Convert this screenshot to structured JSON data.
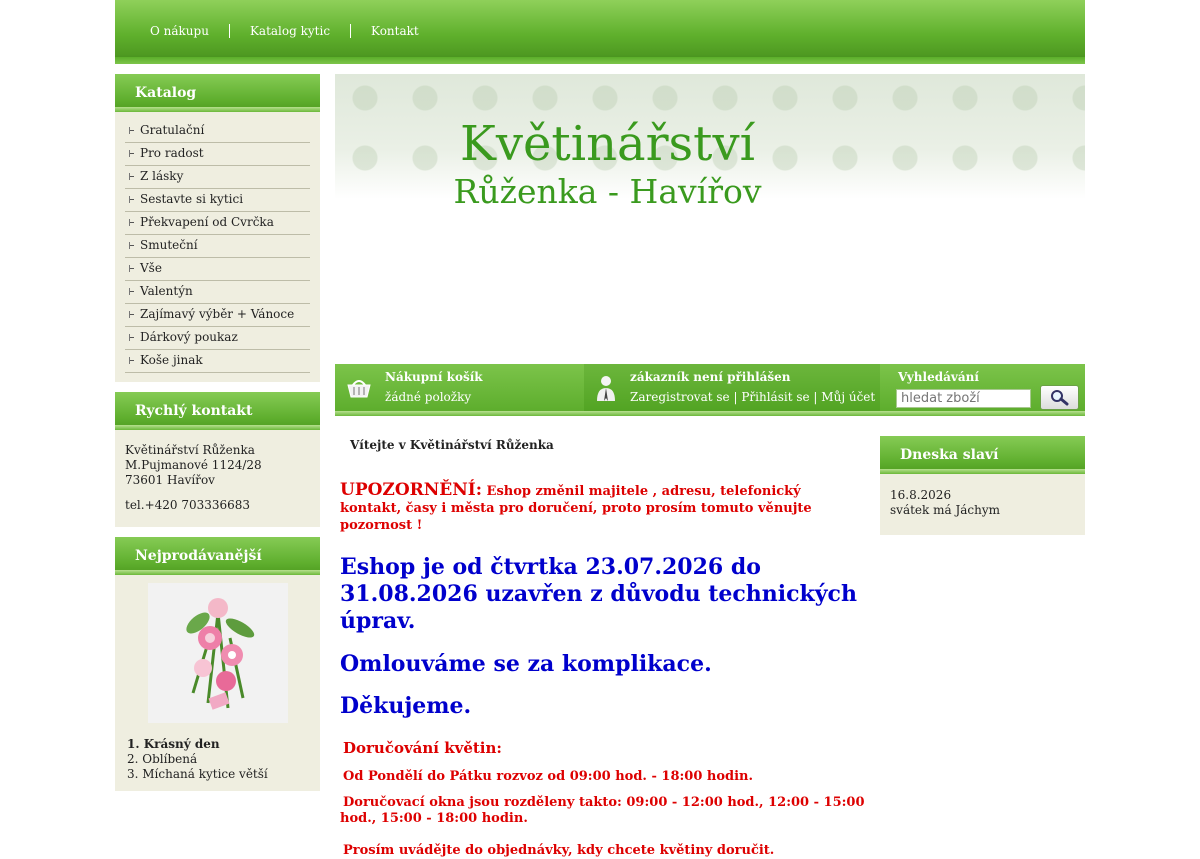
{
  "nav": {
    "items": [
      "O nákupu",
      "Katalog kytic",
      "Kontakt"
    ]
  },
  "catalog": {
    "title": "Katalog",
    "items": [
      "Gratulační",
      "Pro radost",
      "Z lásky",
      "Sestavte si kytici",
      "Překvapení od Cvrčka",
      "Smuteční",
      "Vše",
      "Valentýn",
      "Zajímavý výběr + Vánoce",
      "Dárkový poukaz",
      "Koše jinak"
    ]
  },
  "contact": {
    "title": "Rychlý kontakt",
    "line1": "Květinářství Růženka",
    "line2": "M.Pujmanové 1124/28",
    "line3": "73601 Havířov",
    "phone": "tel.+420 703336683"
  },
  "bestsellers": {
    "title": "Nejprodávanější",
    "items": [
      "1. Krásný den",
      "2. Oblíbená",
      "3. Míchaná kytice větší"
    ]
  },
  "banner": {
    "title": "Květinářství",
    "subtitle": "Růženka - Havířov"
  },
  "cart": {
    "title": "Nákupní košík",
    "status": "žádné položky"
  },
  "user": {
    "title": "zákazník není přihlášen",
    "register": "Zaregistrovat se",
    "login": "Přihlásit se",
    "account": "Můj účet",
    "sep": "|"
  },
  "search": {
    "title": "Vyhledávání",
    "placeholder": "hledat zboží"
  },
  "main": {
    "welcome": "Vítejte v Květinářství Růženka",
    "warn_label": "UPOZORNĚNÍ:",
    "warn_text": " Eshop změnil majitele , adresu, telefonický kontakt, časy i města pro doručení, proto prosím tomuto věnujte pozornost !",
    "closed": "Eshop je od čtvrtka 23.07.2026  do 31.08.2026 uzavřen z důvodu technických úprav.",
    "sorry": "Omlouváme se za komplikace.",
    "thanks": "Děkujeme.",
    "delivery_title": "Doručování květin:",
    "delivery_hours": "Od Pondělí do Pátku rozvoz od 09:00 hod. - 18:00 hodin.",
    "delivery_windows": "Doručovací okna jsou rozděleny takto: 09:00 - 12:00 hod., 12:00 - 15:00 hod., 15:00 - 18:00 hodin.",
    "delivery_note": "Prosím uvádějte do objednávky, kdy chcete květiny doručit."
  },
  "nameday": {
    "title": "Dneska slaví",
    "date": "16.8.2026",
    "text": "svátek má Jáchym"
  }
}
